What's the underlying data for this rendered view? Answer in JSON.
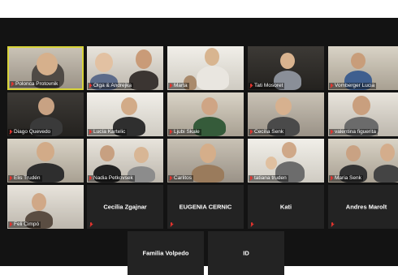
{
  "participants": [
    {
      "name": "Polonca Protovnik",
      "kind": "video",
      "active": true
    },
    {
      "name": "Olga & Andrejka",
      "kind": "video"
    },
    {
      "name": "Marta",
      "kind": "video"
    },
    {
      "name": "Tati Mosoret",
      "kind": "video"
    },
    {
      "name": "Vomberger Lucia",
      "kind": "video"
    },
    {
      "name": "Diago Quevedo",
      "kind": "video"
    },
    {
      "name": "Lucía Kartelic",
      "kind": "video"
    },
    {
      "name": "Ljubi Skale",
      "kind": "video"
    },
    {
      "name": "Cecilia Senk",
      "kind": "video"
    },
    {
      "name": "valentina figuerita",
      "kind": "video"
    },
    {
      "name": "Elis Trudén",
      "kind": "video"
    },
    {
      "name": "Nadia Petkovsek",
      "kind": "video"
    },
    {
      "name": "Carlitos",
      "kind": "video"
    },
    {
      "name": "tatiana truden",
      "kind": "video"
    },
    {
      "name": "Maria Senk",
      "kind": "video"
    },
    {
      "name": "Feli Cimpó",
      "kind": "video"
    },
    {
      "name": "Cecilia Zgajnar",
      "kind": "name"
    },
    {
      "name": "EUGENIA CERNIC",
      "kind": "name"
    },
    {
      "name": "Kati",
      "kind": "name"
    },
    {
      "name": "Andres Marolt",
      "kind": "name"
    },
    {
      "name": "Familia Volpedo",
      "kind": "name"
    },
    {
      "name": "ID",
      "kind": "name"
    }
  ],
  "colors": {
    "active_border": "#d8d43a",
    "muted_icon": "#e3342f",
    "background": "#131313"
  }
}
